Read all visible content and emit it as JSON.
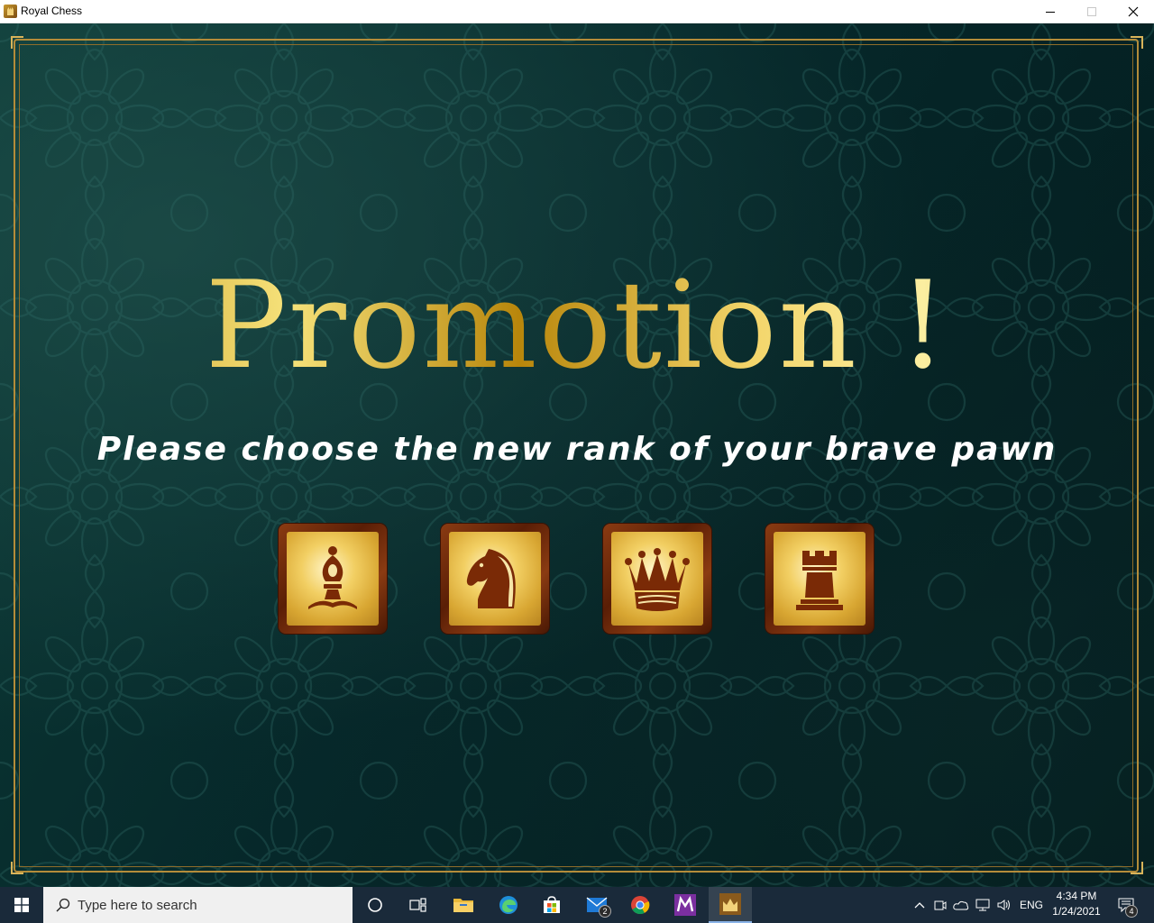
{
  "window": {
    "title": "Royal Chess",
    "icons": [
      "app-crown-icon",
      "minimize-icon",
      "maximize-icon",
      "close-icon"
    ]
  },
  "screen": {
    "title": "Promotion !",
    "subtitle": "Please choose the new rank of your brave pawn",
    "choices": [
      {
        "piece": "bishop",
        "icon": "bishop-icon"
      },
      {
        "piece": "knight",
        "icon": "knight-icon"
      },
      {
        "piece": "queen",
        "icon": "queen-icon"
      },
      {
        "piece": "rook",
        "icon": "rook-icon"
      }
    ],
    "colors": {
      "gold": "#d4a72c",
      "piece_brown": "#7a2a06",
      "frame_wood": "#8a3b12",
      "background": "#06282a"
    }
  },
  "taskbar": {
    "search_placeholder": "Type here to search",
    "mail_badge": "2",
    "language": "ENG",
    "time": "4:34 PM",
    "date": "1/24/2021",
    "notifications_badge": "4"
  }
}
